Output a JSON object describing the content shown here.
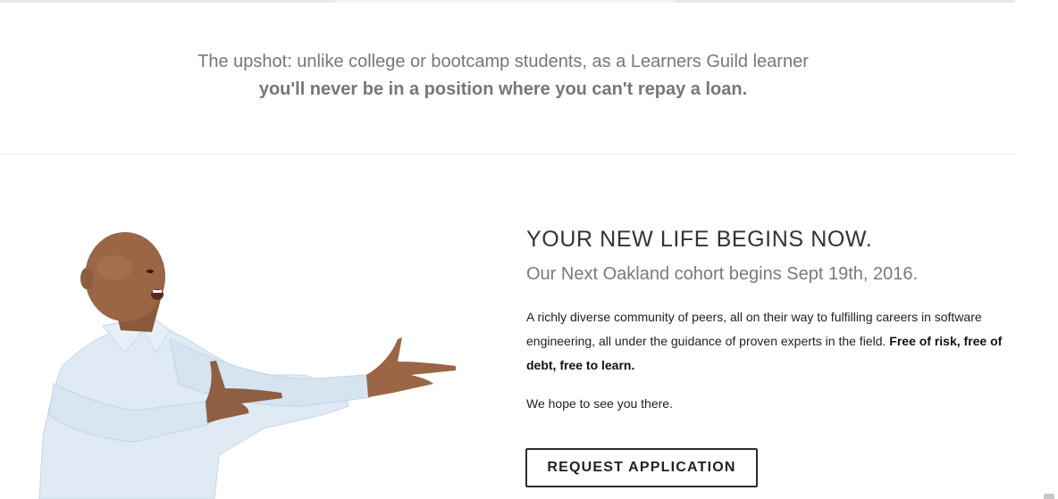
{
  "upshot": {
    "line1": "The upshot: unlike college or bootcamp students, as a Learners Guild learner",
    "line2": "you'll never be in a position where you can't repay a loan."
  },
  "section": {
    "heading": "YOUR NEW LIFE BEGINS NOW.",
    "subheading": "Our Next Oakland cohort begins Sept 19th, 2016.",
    "body_regular": "A richly diverse community of peers, all on their way to fulfilling careers in software engineering, all under the guidance of proven experts in the field.",
    "body_bold": "Free of risk, free of debt, free to learn.",
    "hope": "We hope to see you there.",
    "cta_label": "REQUEST APPLICATION"
  },
  "image": {
    "icon": "excited-man-presenting-photo"
  }
}
